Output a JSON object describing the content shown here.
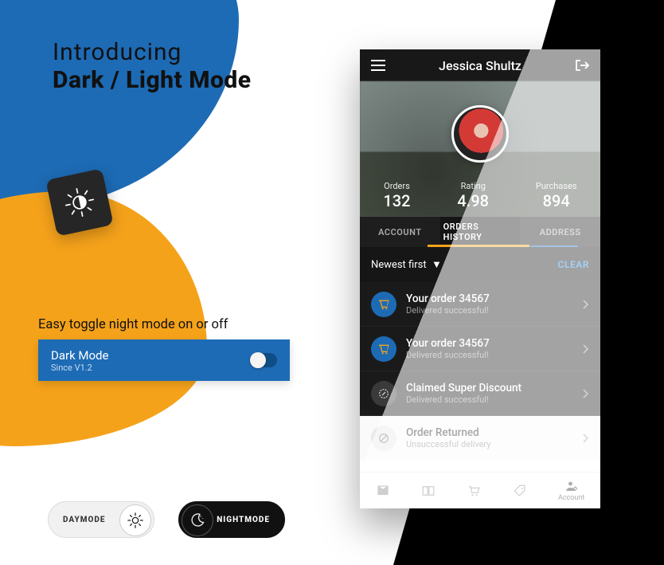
{
  "heading": {
    "line1": "Introducing",
    "line2": "Dark / Light Mode"
  },
  "toggle": {
    "subtitle": "Easy toggle night mode on or off",
    "label": "Dark Mode",
    "since": "Since V1.2"
  },
  "pills": {
    "day": "DAYMODE",
    "night": "NIGHTMODE"
  },
  "phone": {
    "user": "Jessica Shultz",
    "stats": {
      "orders": {
        "label": "Orders",
        "value": "132"
      },
      "rating": {
        "label": "Rating",
        "value": "4.98"
      },
      "purchases": {
        "label": "Purchases",
        "value": "894"
      }
    },
    "tabs": {
      "account": "ACCOUNT",
      "history": "ORDERS HISTORY",
      "address": "ADDRESS"
    },
    "sort": "Newest first",
    "clear": "CLEAR",
    "rows": [
      {
        "title": "Your order 34567",
        "sub": "Delivered successful!"
      },
      {
        "title": "Your order 34567",
        "sub": "Delivered successful!"
      },
      {
        "title": "Claimed Super Discount",
        "sub": "Delivered successful!"
      },
      {
        "title": "Order Returned",
        "sub": "Unsuccessful delivery"
      }
    ],
    "bottomnav": {
      "account": "Account"
    }
  }
}
